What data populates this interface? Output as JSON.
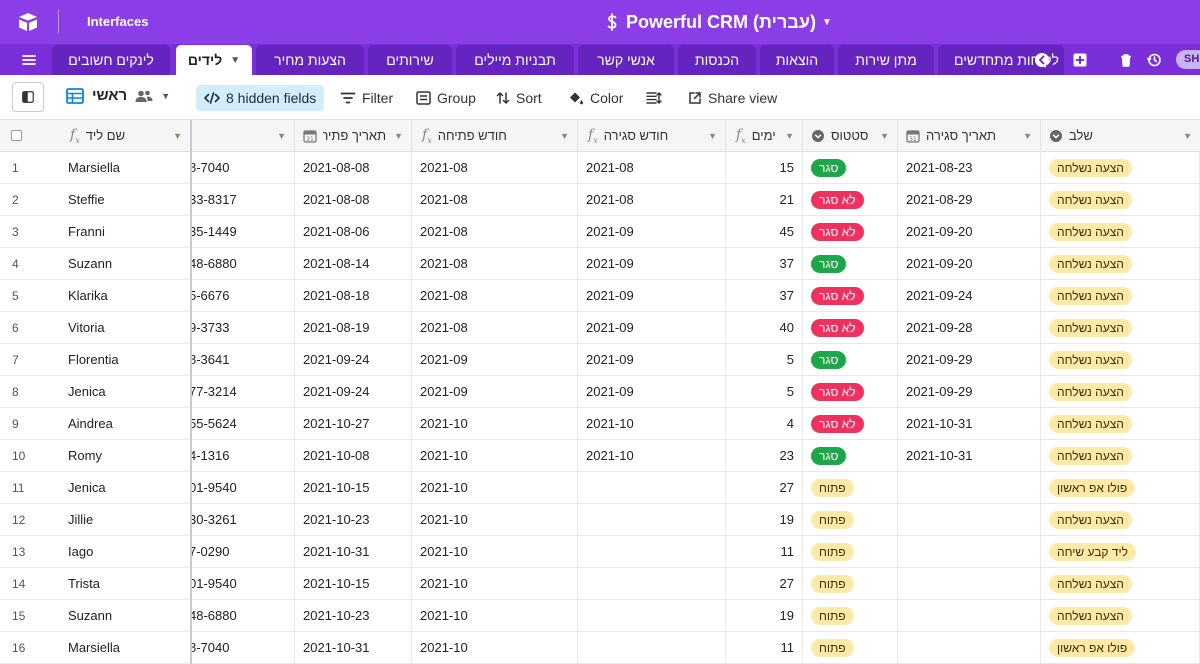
{
  "app": {
    "interfaces_label": "Interfaces",
    "base_name": "Powerful CRM (עברית)",
    "user_badge": "SH",
    "colors": {
      "topbar": "#8b3de8",
      "tabbar": "#7a2fd9",
      "tab": "#6524bf"
    }
  },
  "tabs": [
    {
      "label": "לינקים חשובים"
    },
    {
      "label": "לידים",
      "active": true
    },
    {
      "label": "הצעות מחיר"
    },
    {
      "label": "שירותים"
    },
    {
      "label": "תבניות מיילים"
    },
    {
      "label": "אנשי קשר"
    },
    {
      "label": "הכנסות"
    },
    {
      "label": "הוצאות"
    },
    {
      "label": "מתן שירות"
    },
    {
      "label": "לקוחות מתחדשים"
    }
  ],
  "toolbar": {
    "view_name": "ראשי",
    "hidden_fields": "8 hidden fields",
    "filter": "Filter",
    "group": "Group",
    "sort": "Sort",
    "color": "Color",
    "share": "Share view"
  },
  "columns": {
    "lead_name": "שם ליד",
    "open_date": "תאריך פתיחה",
    "open_month": "חודש פתיחה",
    "close_month": "חודש סגירה",
    "days": "ימים",
    "status": "סטטוס",
    "close_date": "תאריך סגירה",
    "stage": "שלב"
  },
  "rows": [
    {
      "n": "1",
      "name": "Marsiella",
      "phone": "8-7040",
      "open_date": "2021-08-08",
      "open_month": "2021-08",
      "close_month": "2021-08",
      "days": "15",
      "status": "סגר",
      "status_color": "green",
      "close_date": "2021-08-23",
      "stage": "הצעה נשלחה"
    },
    {
      "n": "2",
      "name": "Steffie",
      "phone": "33-8317",
      "open_date": "2021-08-08",
      "open_month": "2021-08",
      "close_month": "2021-08",
      "days": "21",
      "status": "לא סגר",
      "status_color": "red",
      "close_date": "2021-08-29",
      "stage": "הצעה נשלחה"
    },
    {
      "n": "3",
      "name": "Franni",
      "phone": "35-1449",
      "open_date": "2021-08-06",
      "open_month": "2021-08",
      "close_month": "2021-09",
      "days": "45",
      "status": "לא סגר",
      "status_color": "red",
      "close_date": "2021-09-20",
      "stage": "הצעה נשלחה"
    },
    {
      "n": "4",
      "name": "Suzann",
      "phone": "48-6880",
      "open_date": "2021-08-14",
      "open_month": "2021-08",
      "close_month": "2021-09",
      "days": "37",
      "status": "סגר",
      "status_color": "green",
      "close_date": "2021-09-20",
      "stage": "הצעה נשלחה"
    },
    {
      "n": "5",
      "name": "Klarika",
      "phone": "5-6676",
      "open_date": "2021-08-18",
      "open_month": "2021-08",
      "close_month": "2021-09",
      "days": "37",
      "status": "לא סגר",
      "status_color": "red",
      "close_date": "2021-09-24",
      "stage": "הצעה נשלחה"
    },
    {
      "n": "6",
      "name": "Vitoria",
      "phone": "9-3733",
      "open_date": "2021-08-19",
      "open_month": "2021-08",
      "close_month": "2021-09",
      "days": "40",
      "status": "לא סגר",
      "status_color": "red",
      "close_date": "2021-09-28",
      "stage": "הצעה נשלחה"
    },
    {
      "n": "7",
      "name": "Florentia",
      "phone": "8-3641",
      "open_date": "2021-09-24",
      "open_month": "2021-09",
      "close_month": "2021-09",
      "days": "5",
      "status": "סגר",
      "status_color": "green",
      "close_date": "2021-09-29",
      "stage": "הצעה נשלחה"
    },
    {
      "n": "8",
      "name": "Jenica",
      "phone": "77-3214",
      "open_date": "2021-09-24",
      "open_month": "2021-09",
      "close_month": "2021-09",
      "days": "5",
      "status": "לא סגר",
      "status_color": "red",
      "close_date": "2021-09-29",
      "stage": "הצעה נשלחה"
    },
    {
      "n": "9",
      "name": "Aindrea",
      "phone": "55-5624",
      "open_date": "2021-10-27",
      "open_month": "2021-10",
      "close_month": "2021-10",
      "days": "4",
      "status": "לא סגר",
      "status_color": "red",
      "close_date": "2021-10-31",
      "stage": "הצעה נשלחה"
    },
    {
      "n": "10",
      "name": "Romy",
      "phone": "4-1316",
      "open_date": "2021-10-08",
      "open_month": "2021-10",
      "close_month": "2021-10",
      "days": "23",
      "status": "סגר",
      "status_color": "green",
      "close_date": "2021-10-31",
      "stage": "הצעה נשלחה"
    },
    {
      "n": "11",
      "name": "Jenica",
      "phone": "01-9540",
      "open_date": "2021-10-15",
      "open_month": "2021-10",
      "close_month": "",
      "days": "27",
      "status": "פתוח",
      "status_color": "yellow",
      "close_date": "",
      "stage": "פולו אפ ראשון"
    },
    {
      "n": "12",
      "name": "Jillie",
      "phone": "30-3261",
      "open_date": "2021-10-23",
      "open_month": "2021-10",
      "close_month": "",
      "days": "19",
      "status": "פתוח",
      "status_color": "yellow",
      "close_date": "",
      "stage": "הצעה נשלחה"
    },
    {
      "n": "13",
      "name": "Iago",
      "phone": "7-0290",
      "open_date": "2021-10-31",
      "open_month": "2021-10",
      "close_month": "",
      "days": "11",
      "status": "פתוח",
      "status_color": "yellow",
      "close_date": "",
      "stage": "ליד קבע שיחה"
    },
    {
      "n": "14",
      "name": "Trista",
      "phone": "01-9540",
      "open_date": "2021-10-15",
      "open_month": "2021-10",
      "close_month": "",
      "days": "27",
      "status": "פתוח",
      "status_color": "yellow",
      "close_date": "",
      "stage": "הצעה נשלחה"
    },
    {
      "n": "15",
      "name": "Suzann",
      "phone": "48-6880",
      "open_date": "2021-10-23",
      "open_month": "2021-10",
      "close_month": "",
      "days": "19",
      "status": "פתוח",
      "status_color": "yellow",
      "close_date": "",
      "stage": "הצעה נשלחה"
    },
    {
      "n": "16",
      "name": "Marsiella",
      "phone": "8-7040",
      "open_date": "2021-10-31",
      "open_month": "2021-10",
      "close_month": "",
      "days": "11",
      "status": "פתוח",
      "status_color": "yellow",
      "close_date": "",
      "stage": "פולו אפ ראשון"
    }
  ]
}
